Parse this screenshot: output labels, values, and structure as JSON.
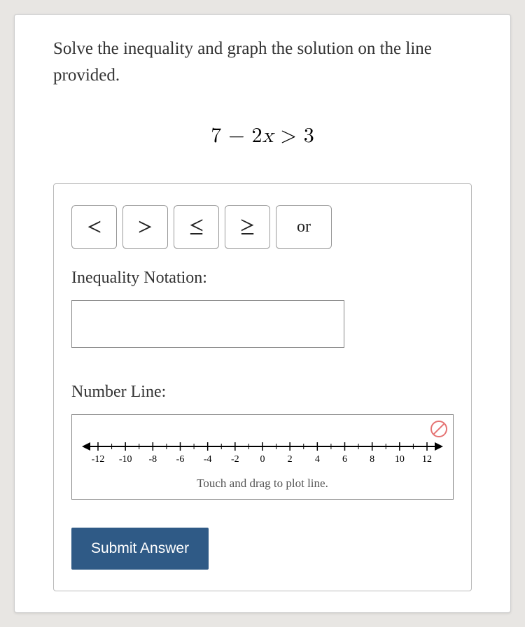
{
  "prompt": "Solve the inequality and graph the solution on the line provided.",
  "equation_parts": {
    "a": "7",
    "op1": "−",
    "b": "2",
    "var": "x",
    "rel": ">",
    "c": "3"
  },
  "symbols": {
    "lt": "<",
    "gt": ">",
    "le": "≤",
    "ge": "≥",
    "or": "or"
  },
  "labels": {
    "inequality_notation": "Inequality Notation:",
    "number_line": "Number Line:",
    "hint": "Touch and drag to plot line.",
    "submit": "Submit Answer"
  },
  "notation_value": "",
  "number_line": {
    "ticks": [
      "-12",
      "-10",
      "-8",
      "-6",
      "-4",
      "-2",
      "0",
      "2",
      "4",
      "6",
      "8",
      "10",
      "12"
    ]
  }
}
